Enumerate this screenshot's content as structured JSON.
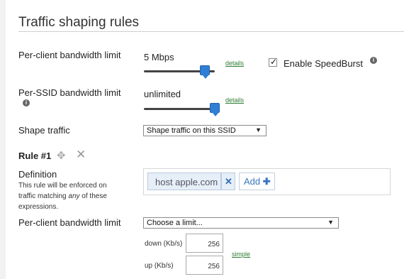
{
  "title": "Traffic shaping rules",
  "per_client": {
    "label": "Per-client bandwidth limit",
    "value": "5 Mbps",
    "details": "details",
    "slider_fraction": 0.86
  },
  "speedburst": {
    "label": "Enable SpeedBurst",
    "checked": true
  },
  "per_ssid": {
    "label": "Per-SSID bandwidth limit",
    "value": "unlimited",
    "details": "details",
    "slider_fraction": 1.0
  },
  "shape": {
    "label": "Shape traffic",
    "selected": "Shape traffic on this SSID"
  },
  "rule": {
    "title": "Rule #1",
    "definition_label": "Definition",
    "definition_help_1": "This rule will be enforced on",
    "definition_help_2a": "traffic matching ",
    "definition_help_any": "any",
    "definition_help_2b": " of these",
    "definition_help_3": "expressions.",
    "expression": "host apple.com",
    "add_label": "Add",
    "limit_label": "Per-client bandwidth limit",
    "limit_selected": "Choose a limit...",
    "down_label": "down (Kb/s)",
    "down_value": "256",
    "up_label": "up (Kb/s)",
    "up_value": "256",
    "simple": "simple"
  },
  "icons": {
    "info": "info-icon",
    "move": "move-icon",
    "remove": "close-icon",
    "checkbox": "checkbox-checked",
    "plus": "plus-icon"
  }
}
